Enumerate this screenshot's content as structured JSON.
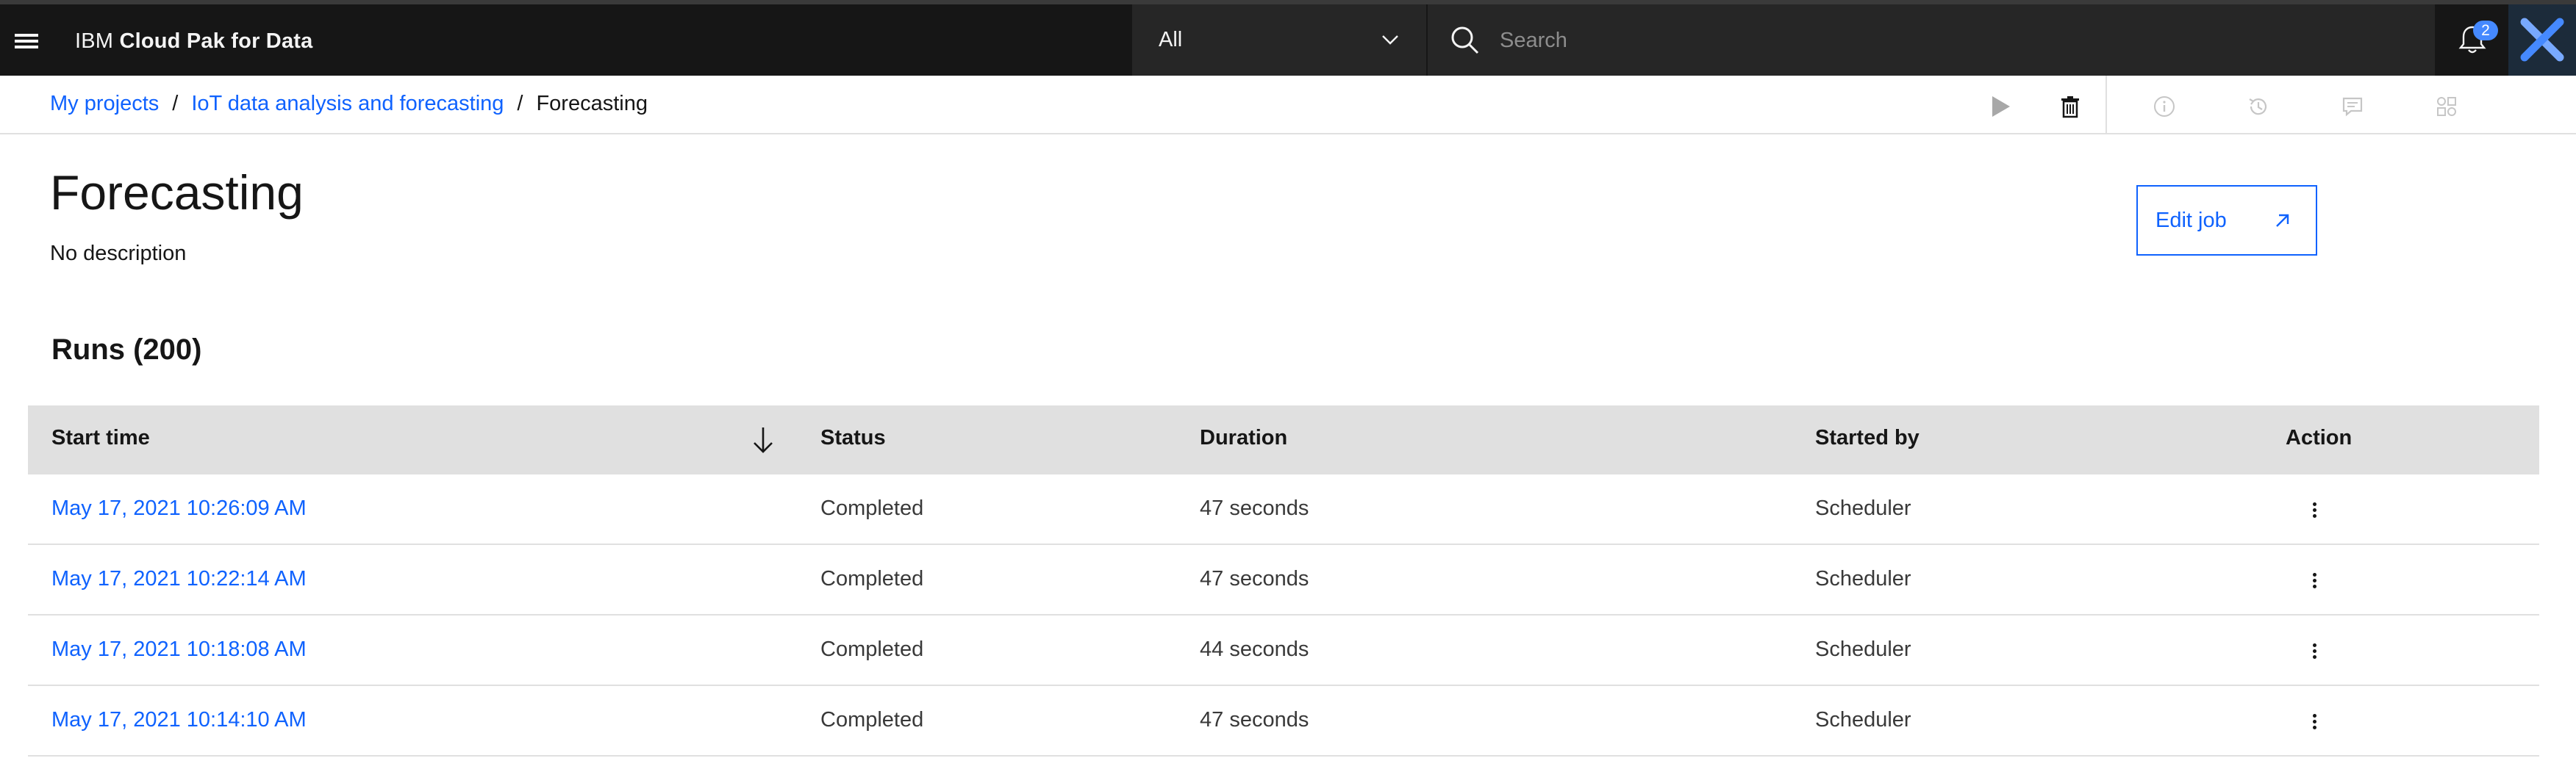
{
  "header": {
    "brand_prefix": "IBM",
    "brand_name": "Cloud Pak for Data",
    "scope_selected": "All",
    "search_placeholder": "Search",
    "notification_count": "2"
  },
  "breadcrumb": {
    "items": [
      {
        "label": "My projects"
      },
      {
        "label": "IoT data analysis and forecasting"
      }
    ],
    "separator": "/",
    "current": "Forecasting"
  },
  "toolbar": {
    "icons": [
      "play-icon",
      "delete-icon",
      "info-icon",
      "history-icon",
      "comment-icon",
      "integrations-icon"
    ]
  },
  "page": {
    "title": "Forecasting",
    "description": "No description",
    "edit_job_label": "Edit job"
  },
  "runs": {
    "title": "Runs (200)",
    "columns": {
      "start_time": "Start time",
      "status": "Status",
      "duration": "Duration",
      "started_by": "Started by",
      "action": "Action"
    },
    "rows": [
      {
        "start_time": "May 17, 2021 10:26:09 AM",
        "status": "Completed",
        "duration": "47 seconds",
        "started_by": "Scheduler"
      },
      {
        "start_time": "May 17, 2021 10:22:14 AM",
        "status": "Completed",
        "duration": "47 seconds",
        "started_by": "Scheduler"
      },
      {
        "start_time": "May 17, 2021 10:18:08 AM",
        "status": "Completed",
        "duration": "44 seconds",
        "started_by": "Scheduler"
      },
      {
        "start_time": "May 17, 2021 10:14:10 AM",
        "status": "Completed",
        "duration": "47 seconds",
        "started_by": "Scheduler"
      }
    ]
  },
  "colors": {
    "header_bg": "#161616",
    "link": "#0f62fe",
    "badge": "#4589ff",
    "table_header_bg": "#e0e0e0"
  }
}
